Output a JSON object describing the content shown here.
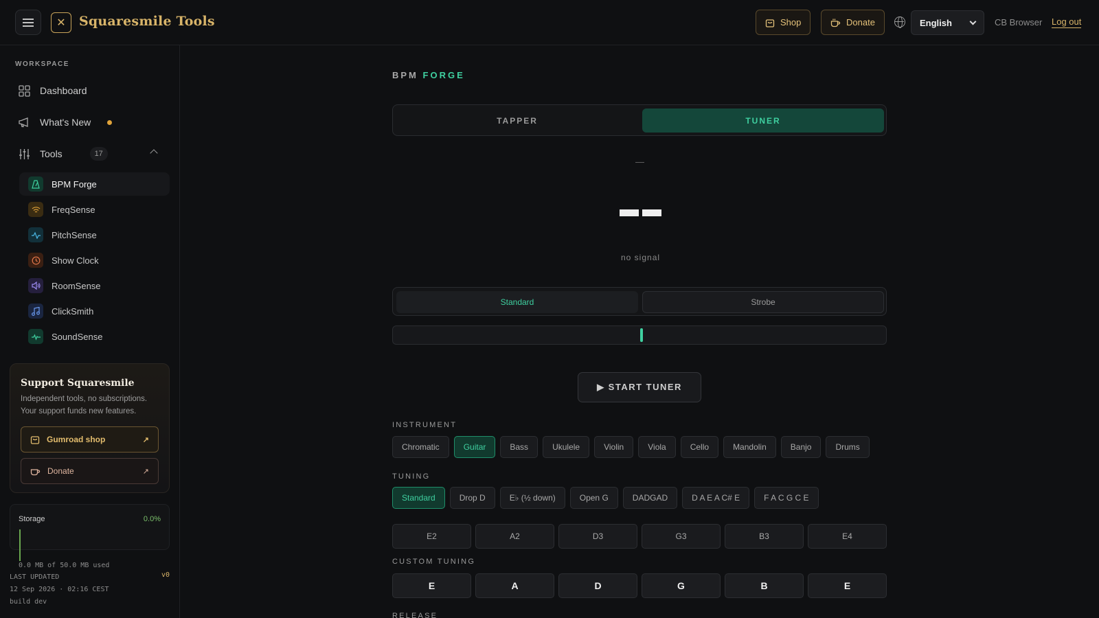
{
  "header": {
    "brand": "Squaresmile Tools",
    "shop_label": "Shop",
    "donate_label": "Donate",
    "language": "English",
    "browser_label": "CB Browser",
    "logout_label": "Log out"
  },
  "sidebar": {
    "workspace_label": "WORKSPACE",
    "nav": [
      {
        "label": "Dashboard",
        "icon": "grid-icon"
      },
      {
        "label": "What's New",
        "icon": "megaphone-icon"
      },
      {
        "label": "Tools",
        "icon": "sliders-icon",
        "count": "17"
      }
    ],
    "tools": [
      {
        "label": "BPM Forge",
        "icon": "metronome-icon",
        "color": "#3fd0a0",
        "bg": "#113a2e"
      },
      {
        "label": "FreqSense",
        "icon": "wifi-icon",
        "color": "#e0a33a",
        "bg": "#3a2c12"
      },
      {
        "label": "PitchSense",
        "icon": "pulse-icon",
        "color": "#4bb8e6",
        "bg": "#12303a"
      },
      {
        "label": "Show Clock",
        "icon": "clock-icon",
        "color": "#e6784b",
        "bg": "#3a1f12"
      },
      {
        "label": "RoomSense",
        "icon": "speaker-icon",
        "color": "#9b8bf0",
        "bg": "#251f3d"
      },
      {
        "label": "ClickSmith",
        "icon": "music-note-icon",
        "color": "#6a9af0",
        "bg": "#1a2540"
      },
      {
        "label": "SoundSense",
        "icon": "wave-icon",
        "color": "#3fd0a0",
        "bg": "#113a2e"
      }
    ],
    "support": {
      "title": "Support Squaresmile",
      "text": "Independent tools, no subscriptions. Your support funds new features.",
      "shop_label": "Gumroad shop",
      "donate_label": "Donate"
    },
    "storage": {
      "label": "Storage",
      "percent": "0.0%",
      "used": "0.0 MB of 50.0 MB used"
    },
    "footer": {
      "last_updated_label": "LAST UPDATED",
      "date": "12 Sep 2026 · 02:16 CEST",
      "build": "build dev",
      "version": "v0"
    }
  },
  "main": {
    "title_a": "BPM",
    "title_b": "FORGE",
    "tabs": [
      "TAPPER",
      "TUNER"
    ],
    "dash": "—",
    "status": "no signal",
    "modes": [
      "Standard",
      "Strobe"
    ],
    "start_label": "▶ START TUNER",
    "instrument_label": "INSTRUMENT",
    "instruments": [
      "Chromatic",
      "Guitar",
      "Bass",
      "Ukulele",
      "Violin",
      "Viola",
      "Cello",
      "Mandolin",
      "Banjo",
      "Drums"
    ],
    "tuning_label": "TUNING",
    "tunings": [
      "Standard",
      "Drop D",
      "E♭ (½ down)",
      "Open G",
      "DADGAD",
      "D A E A C# E",
      "F A C G C E"
    ],
    "strings": [
      "E2",
      "A2",
      "D3",
      "G3",
      "B3",
      "E4"
    ],
    "custom_label": "CUSTOM TUNING",
    "custom": [
      "E",
      "A",
      "D",
      "G",
      "B",
      "E"
    ],
    "release_label": "RELEASE"
  }
}
